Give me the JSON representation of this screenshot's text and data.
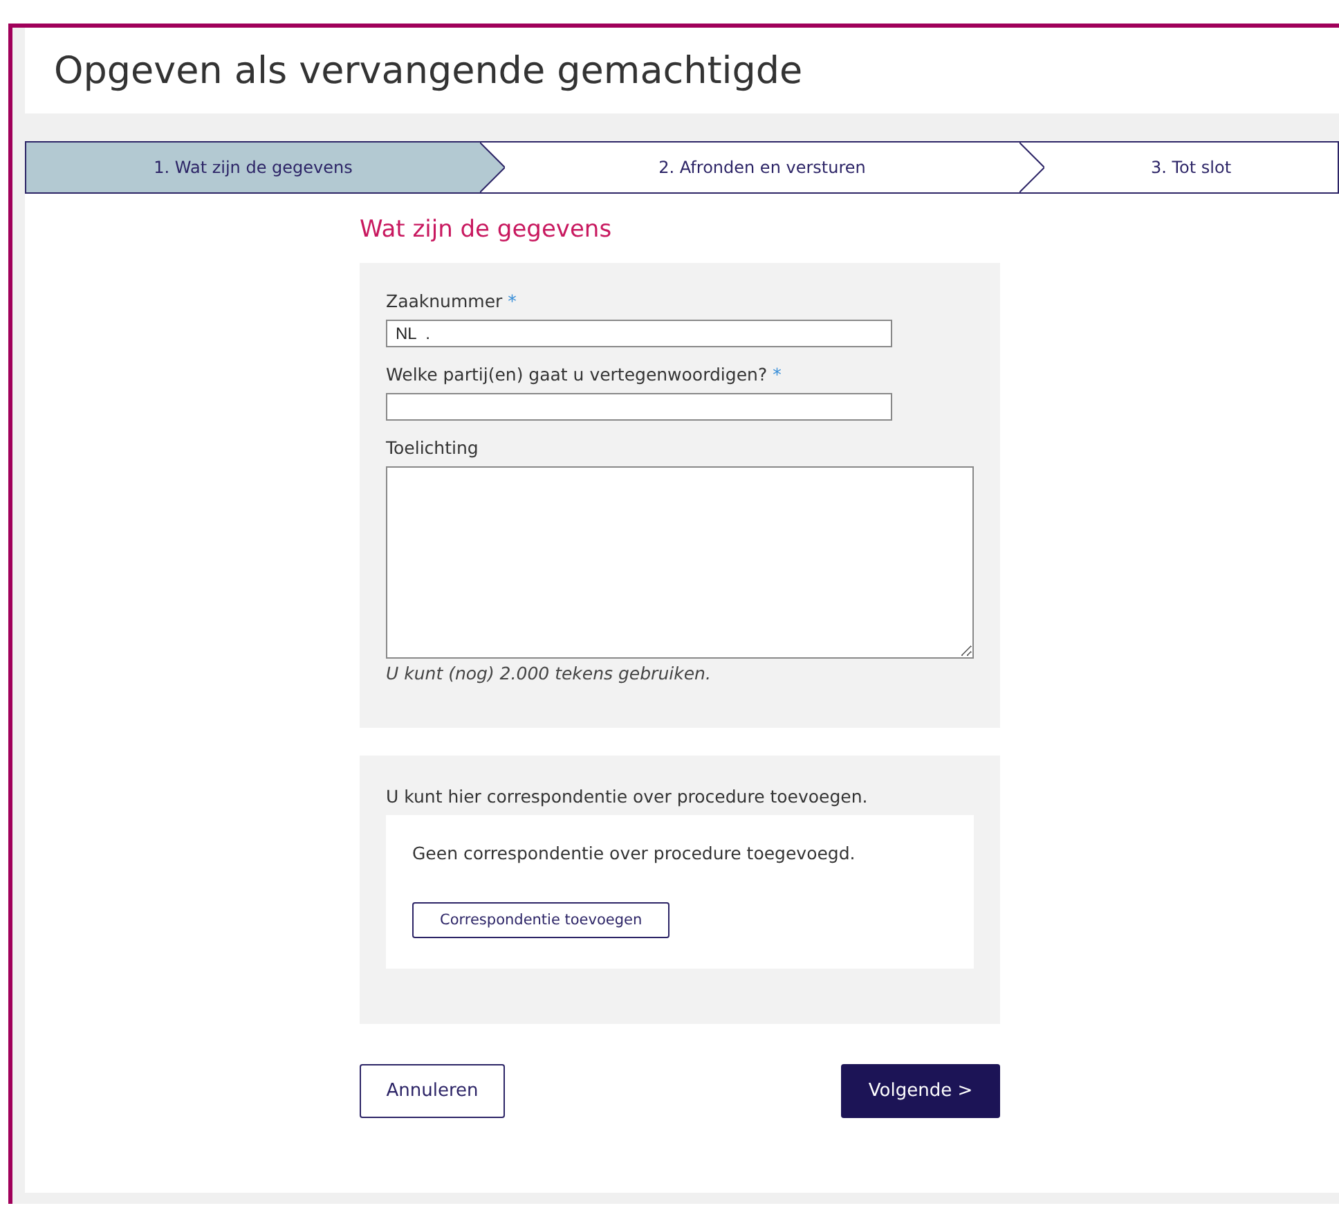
{
  "page_title": "Opgeven als vervangende gemachtigde",
  "steps": [
    {
      "label": "1. Wat zijn de gegevens",
      "selected": true
    },
    {
      "label": "2. Afronden en versturen",
      "selected": false
    },
    {
      "label": "3. Tot slot",
      "selected": false
    }
  ],
  "section_title": "Wat zijn de gegevens",
  "fields": [
    {
      "kind": "input",
      "label": "Zaaknummer",
      "required": true,
      "value": "NL  ."
    },
    {
      "kind": "input",
      "label": "Welke partij(en) gaat u vertegenwoordigen?",
      "required": true
    },
    {
      "kind": "textarea",
      "label": "Toelichting",
      "hint": "U kunt (nog) 2.000 tekens gebruiken."
    }
  ],
  "required_mark": "*",
  "correspondence": {
    "intro": "U kunt hier correspondentie over procedure toevoegen.",
    "empty_text": "Geen correspondentie over procedure toegevoegd.",
    "add_button": "Correspondentie toevoegen"
  },
  "buttons": {
    "cancel": "Annuleren",
    "next": "Volgende >"
  }
}
